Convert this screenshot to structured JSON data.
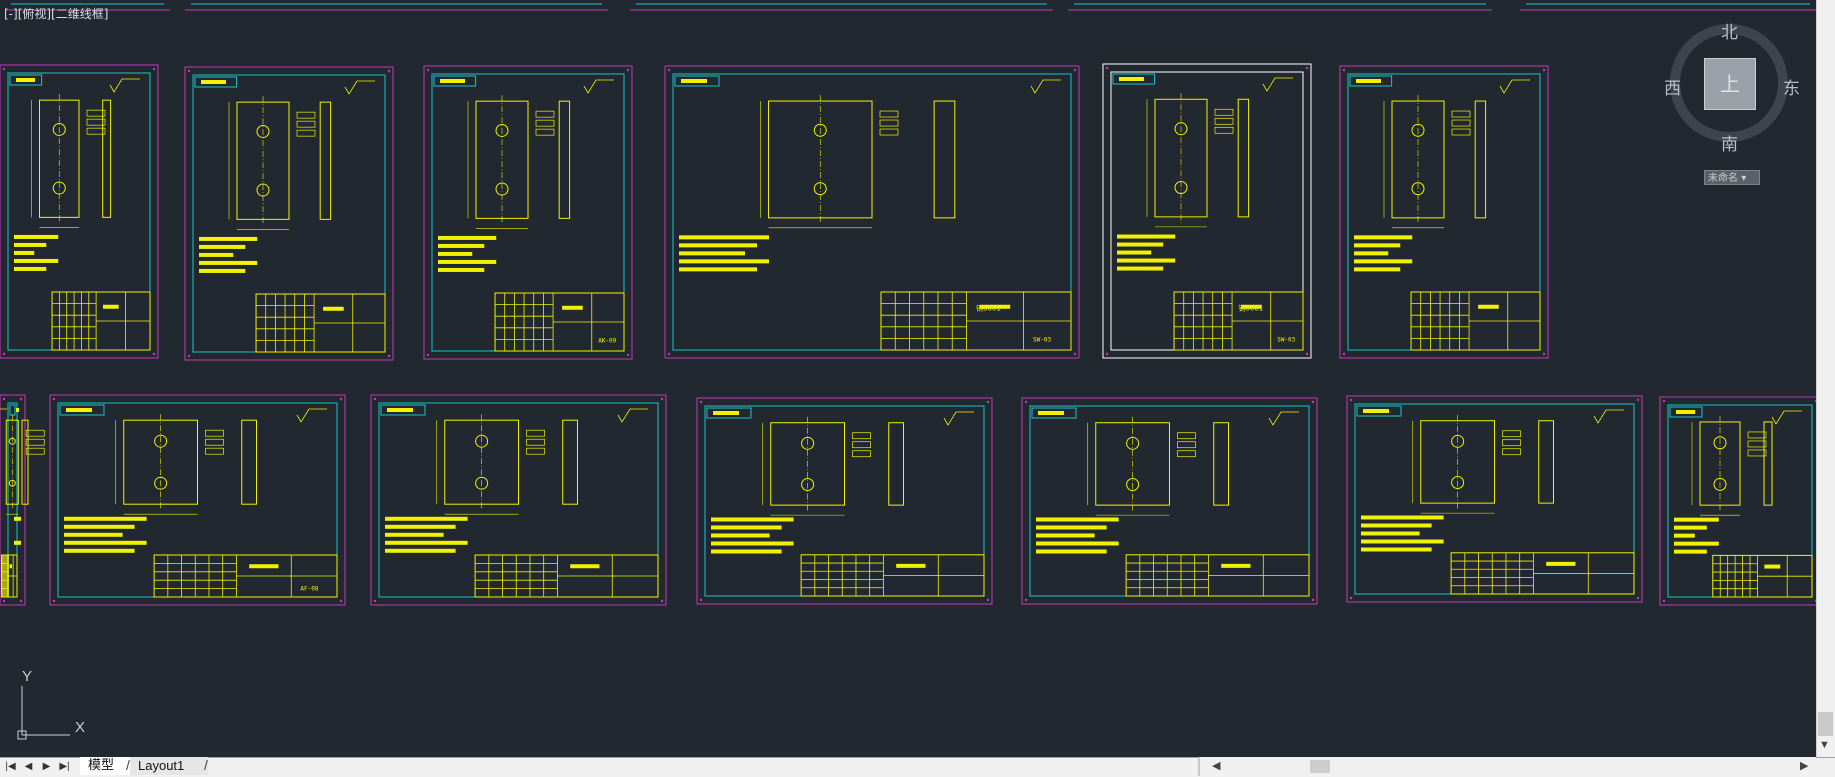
{
  "viewport": {
    "label": "[-][俯视][二维线框]"
  },
  "viewcube": {
    "north": "北",
    "south": "南",
    "east": "东",
    "west": "西",
    "face": "上",
    "wcs_label": "未命名"
  },
  "ucs": {
    "y_label": "Y",
    "x_label": "X"
  },
  "tabs": {
    "model": "模型",
    "layout": "Layout1"
  },
  "nav": {
    "first": "|◀",
    "prev": "◀",
    "next": "▶",
    "last": "▶|"
  },
  "drawings": [
    {
      "row": 1,
      "title_block_code": "",
      "part_number": ""
    },
    {
      "row": 1,
      "title_block_code": "",
      "part_number": ""
    },
    {
      "row": 1,
      "title_block_code": "",
      "part_number": "AK-09"
    },
    {
      "row": 1,
      "title_block_code": "钢0001",
      "part_number": "SW-03"
    },
    {
      "row": 1,
      "title_block_code": "钢0001",
      "part_number": "SW-03"
    },
    {
      "row": 1,
      "title_block_code": "",
      "part_number": ""
    },
    {
      "row": 2,
      "title_block_code": "",
      "part_number": ""
    },
    {
      "row": 2,
      "title_block_code": "",
      "part_number": "AF-08"
    },
    {
      "row": 2,
      "title_block_code": "",
      "part_number": ""
    },
    {
      "row": 2,
      "title_block_code": "",
      "part_number": ""
    },
    {
      "row": 2,
      "title_block_code": "",
      "part_number": ""
    },
    {
      "row": 2,
      "title_block_code": "",
      "part_number": ""
    },
    {
      "row": 2,
      "title_block_code": "",
      "part_number": ""
    }
  ],
  "colors": {
    "background": "#212830",
    "frame_magenta": "#c23ab8",
    "frame_cyan": "#17c3c9",
    "geometry_yellow": "#f2f200",
    "selected_frame": "#ffffff"
  }
}
